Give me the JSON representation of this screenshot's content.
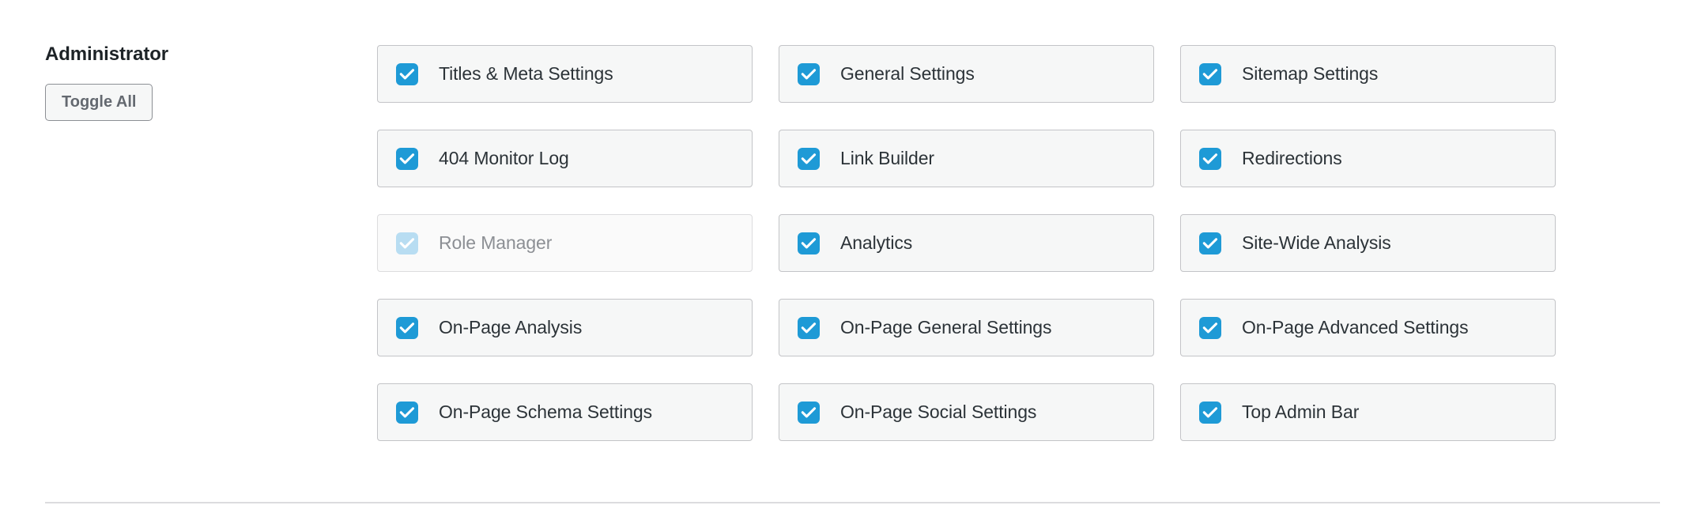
{
  "role": {
    "title": "Administrator",
    "toggle_all_label": "Toggle All"
  },
  "colors": {
    "checkbox_checked": "#1e9ad6",
    "checkbox_disabled": "#b8ddf2",
    "item_background": "#f6f7f7",
    "item_border": "#c3c4c7",
    "label_text": "#2c3338",
    "label_text_disabled": "#8c8f94",
    "divider": "#dcdcde"
  },
  "capabilities": [
    {
      "label": "Titles & Meta Settings",
      "checked": true,
      "disabled": false
    },
    {
      "label": "General Settings",
      "checked": true,
      "disabled": false
    },
    {
      "label": "Sitemap Settings",
      "checked": true,
      "disabled": false
    },
    {
      "label": "404 Monitor Log",
      "checked": true,
      "disabled": false
    },
    {
      "label": "Link Builder",
      "checked": true,
      "disabled": false
    },
    {
      "label": "Redirections",
      "checked": true,
      "disabled": false
    },
    {
      "label": "Role Manager",
      "checked": true,
      "disabled": true
    },
    {
      "label": "Analytics",
      "checked": true,
      "disabled": false
    },
    {
      "label": "Site-Wide Analysis",
      "checked": true,
      "disabled": false
    },
    {
      "label": "On-Page Analysis",
      "checked": true,
      "disabled": false
    },
    {
      "label": "On-Page General Settings",
      "checked": true,
      "disabled": false
    },
    {
      "label": "On-Page Advanced Settings",
      "checked": true,
      "disabled": false
    },
    {
      "label": "On-Page Schema Settings",
      "checked": true,
      "disabled": false
    },
    {
      "label": "On-Page Social Settings",
      "checked": true,
      "disabled": false
    },
    {
      "label": "Top Admin Bar",
      "checked": true,
      "disabled": false
    }
  ]
}
